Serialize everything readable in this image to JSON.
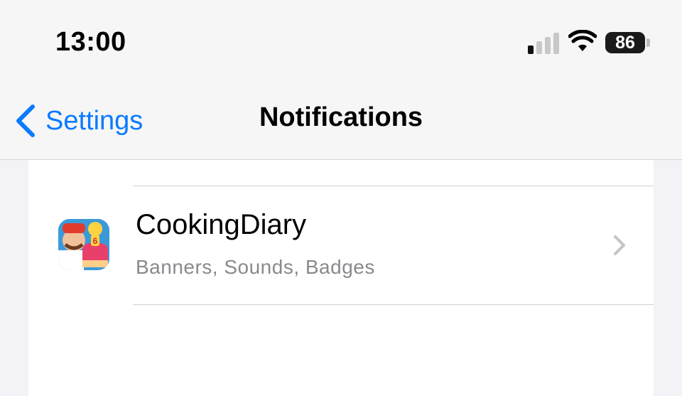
{
  "status_bar": {
    "time": "13:00",
    "battery": "86",
    "icons": [
      "cellular-signal-icon",
      "wifi-icon",
      "battery-icon"
    ]
  },
  "nav": {
    "back_label": "Settings",
    "title": "Notifications"
  },
  "list": {
    "rows": [
      {
        "app_name": "CookingDiary",
        "subtitle": "Banners, Sounds, Badges"
      }
    ]
  },
  "colors": {
    "accent": "#0a7aff",
    "secondary_text": "#8a8a8e",
    "page_bg": "#f2f2f7"
  }
}
